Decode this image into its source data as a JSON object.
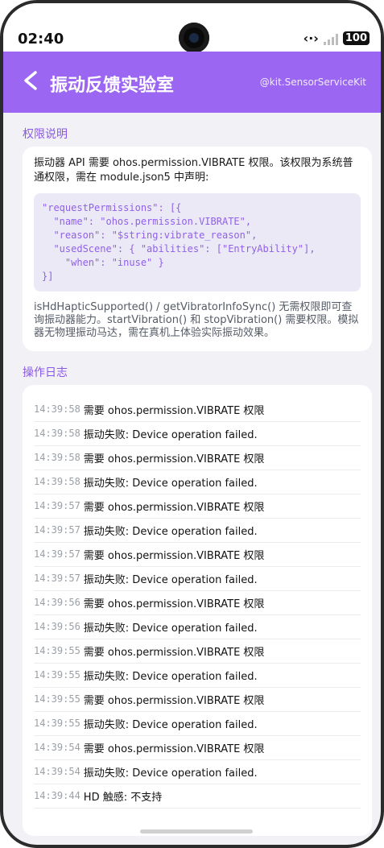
{
  "status": {
    "time": "02:40",
    "battery": "100"
  },
  "header": {
    "back_icon": "chevron-left-icon",
    "title": "振动反馈实验室",
    "kit": "@kit.SensorServiceKit",
    "accent": "#9b66f2"
  },
  "permissions": {
    "section_title": "权限说明",
    "description": "振动器 API 需要 ohos.permission.VIBRATE 权限。该权限为系统普通权限，需在 module.json5 中声明:",
    "code": [
      "\"requestPermissions\": [{",
      "  \"name\": \"ohos.permission.VIBRATE\",",
      "  \"reason\": \"$string:vibrate_reason\",",
      "  \"usedScene\": { \"abilities\": [\"EntryAbility\"],",
      "    \"when\": \"inuse\" }",
      "}]"
    ],
    "note": "isHdHapticSupported() / getVibratorInfoSync() 无需权限即可查询振动器能力。startVibration() 和 stopVibration() 需要权限。模拟器无物理振动马达，需在真机上体验实际振动效果。"
  },
  "log": {
    "section_title": "操作日志",
    "entries": [
      {
        "time": "14:39:58",
        "message": "需要 ohos.permission.VIBRATE 权限"
      },
      {
        "time": "14:39:58",
        "message": "振动失败: Device operation failed."
      },
      {
        "time": "14:39:58",
        "message": "需要 ohos.permission.VIBRATE 权限"
      },
      {
        "time": "14:39:58",
        "message": "振动失败: Device operation failed."
      },
      {
        "time": "14:39:57",
        "message": "需要 ohos.permission.VIBRATE 权限"
      },
      {
        "time": "14:39:57",
        "message": "振动失败: Device operation failed."
      },
      {
        "time": "14:39:57",
        "message": "需要 ohos.permission.VIBRATE 权限"
      },
      {
        "time": "14:39:57",
        "message": "振动失败: Device operation failed."
      },
      {
        "time": "14:39:56",
        "message": "需要 ohos.permission.VIBRATE 权限"
      },
      {
        "time": "14:39:56",
        "message": "振动失败: Device operation failed."
      },
      {
        "time": "14:39:55",
        "message": "需要 ohos.permission.VIBRATE 权限"
      },
      {
        "time": "14:39:55",
        "message": "振动失败: Device operation failed."
      },
      {
        "time": "14:39:55",
        "message": "需要 ohos.permission.VIBRATE 权限"
      },
      {
        "time": "14:39:55",
        "message": "振动失败: Device operation failed."
      },
      {
        "time": "14:39:54",
        "message": "需要 ohos.permission.VIBRATE 权限"
      },
      {
        "time": "14:39:54",
        "message": "振动失败: Device operation failed."
      },
      {
        "time": "14:39:44",
        "message": "HD 触感: 不支持"
      }
    ]
  }
}
